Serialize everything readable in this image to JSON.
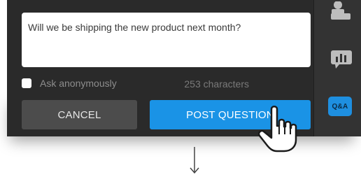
{
  "question": {
    "text": "Will we be shipping the new product next month?"
  },
  "anonymous": {
    "label": "Ask anonymously",
    "checked": false
  },
  "character_count": "253 characters",
  "buttons": {
    "cancel": "CANCEL",
    "post": "POST QUESTION"
  },
  "rail": {
    "qa_badge": "Q&A",
    "icons": [
      "people-icon",
      "chart-icon",
      "qa-icon"
    ]
  },
  "colors": {
    "accent": "#1a93e6",
    "panel": "#2a2a2a",
    "cancel_button": "#4c4c4c"
  }
}
